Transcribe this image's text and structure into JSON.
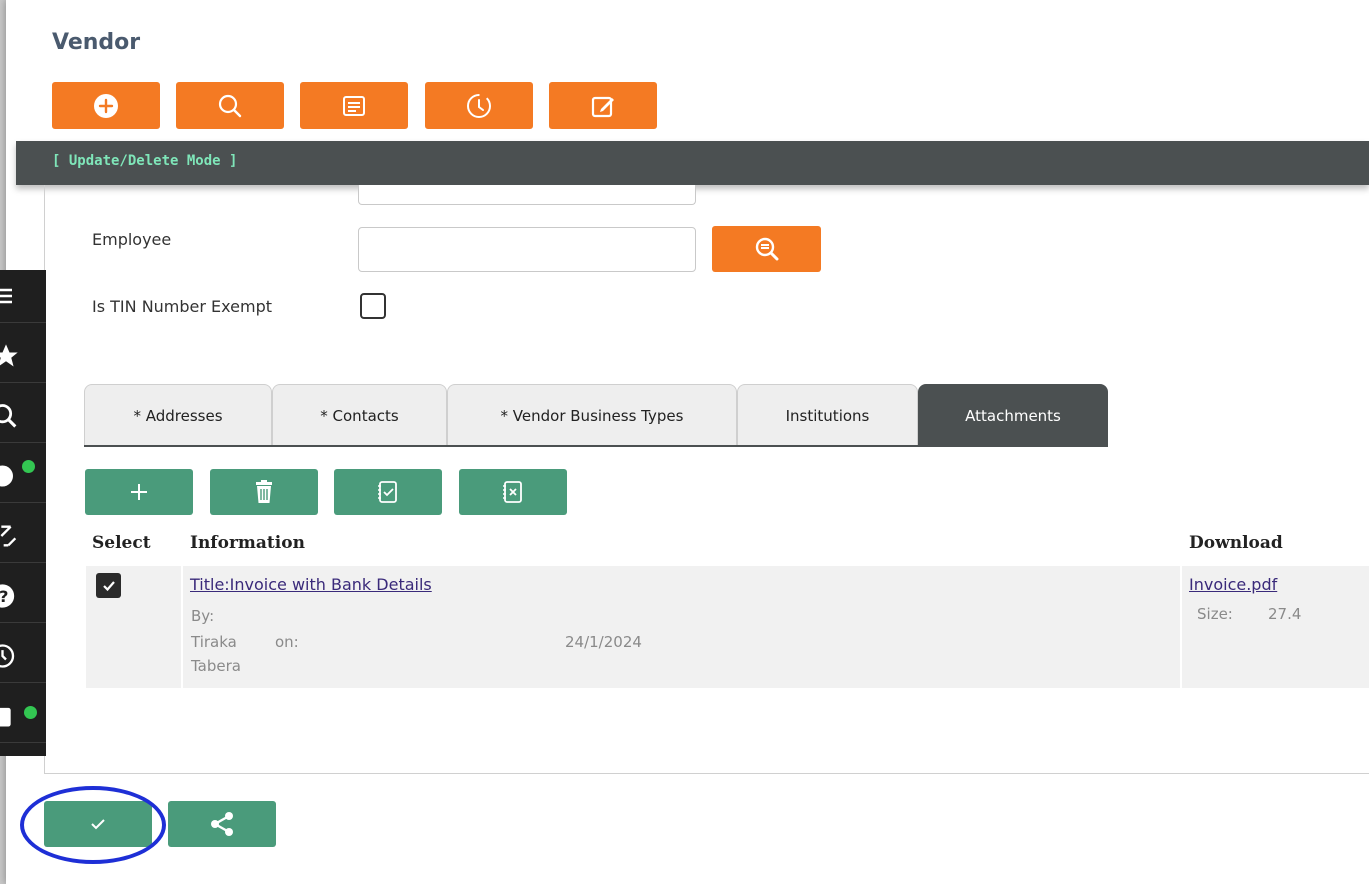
{
  "page": {
    "title": "Vendor"
  },
  "toolbar": {
    "buttons": [
      {
        "icon": "add-circle-icon"
      },
      {
        "icon": "search-icon"
      },
      {
        "icon": "list-icon"
      },
      {
        "icon": "history-icon"
      },
      {
        "icon": "edit-icon"
      }
    ]
  },
  "mode": {
    "label": "[ Update/Delete Mode ]"
  },
  "form": {
    "employee_label": "Employee",
    "employee_value": "",
    "tin_exempt_label": "Is TIN Number Exempt",
    "tin_exempt_checked": false
  },
  "side_nav": {
    "items": [
      "menu-icon",
      "star-icon",
      "search-icon",
      "notification-icon",
      "expand-icon",
      "help-icon",
      "clock-icon",
      "tasks-icon"
    ]
  },
  "tabs": [
    {
      "label": "* Addresses"
    },
    {
      "label": "* Contacts"
    },
    {
      "label": "* Vendor Business Types"
    },
    {
      "label": "Institutions"
    },
    {
      "label": "Attachments",
      "active": true
    }
  ],
  "attachments": {
    "actions": [
      "add-icon",
      "trash-icon",
      "check-list-icon",
      "cross-list-icon"
    ],
    "columns": {
      "select": "Select",
      "information": "Information",
      "download": "Download"
    },
    "rows": [
      {
        "selected": true,
        "title": "Title:Invoice with Bank Details",
        "by_label": "By:",
        "author_first": "Tiraka",
        "author_last": "Tabera",
        "on_label": "on:",
        "date": "24/1/2024",
        "file_name": "Invoice.pdf",
        "size_label": "Size:",
        "size_value": "27.4"
      }
    ]
  },
  "footer": {
    "buttons": [
      "confirm-icon",
      "share-icon"
    ]
  },
  "colors": {
    "orange": "#f47a23",
    "green": "#4a9b7b",
    "dark_bar": "#4b5051",
    "mode_text": "#7fe6b9",
    "highlight": "#1e2fd6"
  }
}
